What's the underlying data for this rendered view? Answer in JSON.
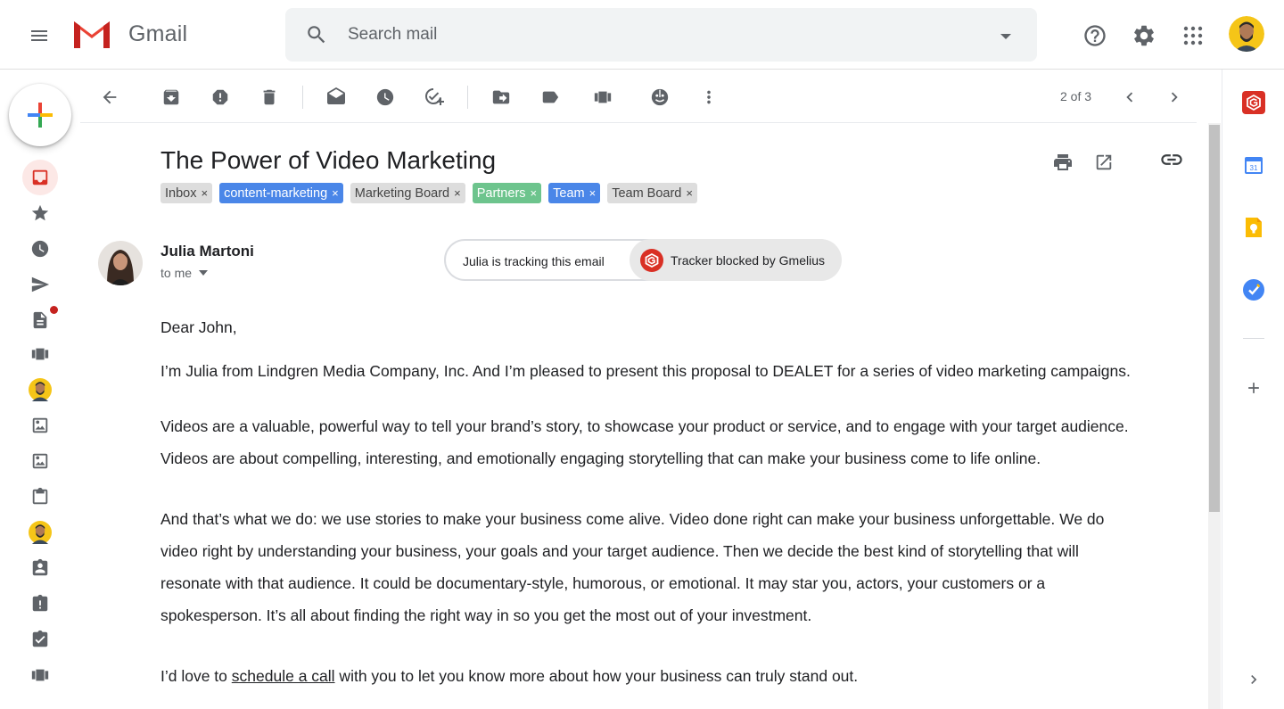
{
  "app": {
    "name": "Gmail"
  },
  "search": {
    "placeholder": "Search mail"
  },
  "toolbar": {
    "pager": "2 of 3"
  },
  "email": {
    "subject": "The Power of Video Marketing",
    "labels": [
      {
        "text": "Inbox",
        "style": "grey"
      },
      {
        "text": "content-marketing",
        "style": "blue"
      },
      {
        "text": "Marketing Board",
        "style": "grey"
      },
      {
        "text": "Partners",
        "style": "green"
      },
      {
        "text": "Team",
        "style": "blue"
      },
      {
        "text": "Team Board",
        "style": "grey"
      }
    ],
    "label_remove": "×",
    "sender": {
      "name": "Julia Martoni",
      "recipient": "to me"
    },
    "tracker": {
      "notice": "Julia is tracking this email",
      "blocked": "Tracker blocked by Gmelius"
    },
    "body": {
      "greeting": "Dear John,",
      "p1": "I’m Julia from Lindgren Media Company, Inc. And I’m pleased to present this proposal to DEALET for a series of video marketing campaigns.",
      "p2a": "Videos are a valuable, powerful way to tell your brand’s story, to showcase your product or service, and to engage with your target audience.",
      "p2b": "Videos are about compelling, interesting, and emotionally engaging storytelling that can make your business come to life online.",
      "p3a": "And that’s what we do: we use stories to make your business come alive. Video done right can make your business unforgettable. We do",
      "p3b": "video right by understanding your business, your goals and your target audience. Then we decide the best kind of storytelling that will",
      "p3c": "resonate with that audience. It could be documentary-style, humorous, or emotional. It may star you, actors, your customers or a",
      "p3d": "spokesperson. It’s all about finding the right way in so you get the most out of your investment.",
      "p4_before": "I’d love to ",
      "p4_link": "schedule a call",
      "p4_after": " with you to let you know more about how your business can truly stand out."
    }
  },
  "right_rail": {
    "calendar_day": "31"
  },
  "colors": {
    "accent_red": "#d93025",
    "label_blue": "#4a86e8",
    "label_green": "#6dc48d",
    "label_grey": "#dddddd"
  }
}
